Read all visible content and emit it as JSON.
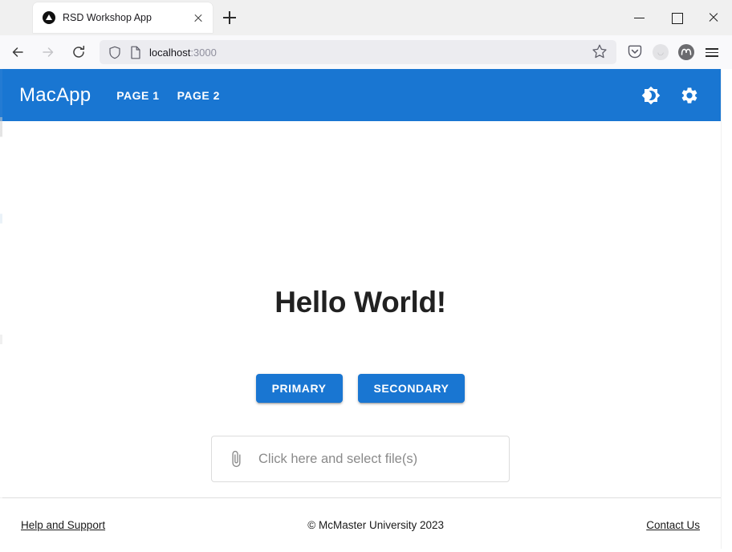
{
  "browser": {
    "tab": {
      "title": "RSD Workshop App",
      "favicon": "triangle-in-circle-icon",
      "close_label": "×"
    },
    "new_tab_label": "+",
    "window_controls": {
      "minimize": "minimize-icon",
      "maximize": "maximize-icon",
      "close": "close-icon"
    },
    "toolbar": {
      "back": "back-arrow-icon",
      "forward": "forward-arrow-icon",
      "reload": "reload-icon",
      "shield": "shield-icon",
      "page_icon": "page-document-icon",
      "url_host": "localhost",
      "url_port": ":3000",
      "url_full": "localhost:3000",
      "bookmark": "star-icon",
      "pocket": "pocket-icon",
      "avatar": "account-avatar-icon",
      "extension": "extension-icon",
      "menu": "hamburger-menu-icon"
    }
  },
  "app": {
    "brand": "MacApp",
    "nav": [
      {
        "label": "PAGE 1"
      },
      {
        "label": "PAGE 2"
      }
    ],
    "actions": [
      {
        "name": "theme-toggle",
        "icon": "brightness-moon-icon"
      },
      {
        "name": "settings",
        "icon": "gear-icon"
      }
    ],
    "colors": {
      "primary": "#1976d2",
      "heading": "#212121",
      "muted_text": "#8a8a8a",
      "border": "#dcdcdc"
    }
  },
  "main": {
    "heading": "Hello World!",
    "buttons": [
      {
        "label": "PRIMARY",
        "variant": "primary"
      },
      {
        "label": "SECONDARY",
        "variant": "secondary"
      }
    ],
    "uploader": {
      "icon": "paperclip-icon",
      "placeholder": "Click here and select file(s)"
    }
  },
  "footer": {
    "left_link": "Help and Support",
    "center_text": "© McMaster University 2023",
    "right_link": "Contact Us"
  }
}
